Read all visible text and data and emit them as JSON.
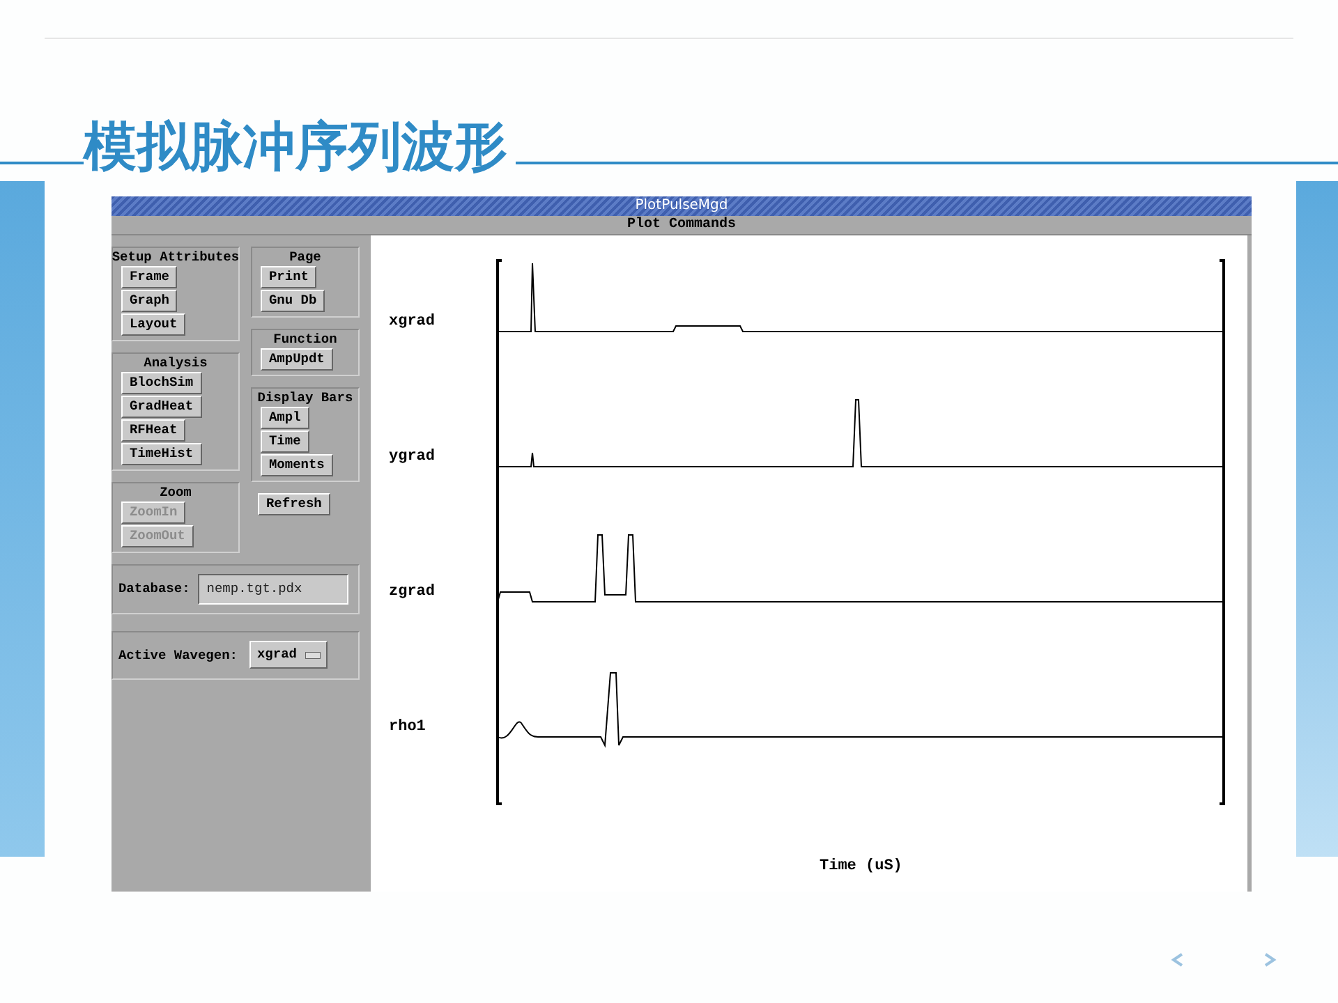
{
  "slide": {
    "title": "模拟脉冲序列波形"
  },
  "window": {
    "title": "PlotPulseMgd",
    "menu_label": "Plot Commands"
  },
  "panel": {
    "columns": [
      [
        {
          "kind": "group",
          "title": "Setup Attributes",
          "buttons": [
            {
              "label": "Frame",
              "disabled": false
            },
            {
              "label": "Graph",
              "disabled": false
            },
            {
              "label": "Layout",
              "disabled": false
            }
          ]
        },
        {
          "kind": "group",
          "title": "Analysis",
          "buttons": [
            {
              "label": "BlochSim",
              "disabled": false
            },
            {
              "label": "GradHeat",
              "disabled": false
            },
            {
              "label": "RFHeat",
              "disabled": false
            },
            {
              "label": "TimeHist",
              "disabled": false
            }
          ]
        },
        {
          "kind": "group",
          "title": "Zoom",
          "buttons": [
            {
              "label": "ZoomIn",
              "disabled": true
            },
            {
              "label": "ZoomOut",
              "disabled": true
            }
          ]
        }
      ],
      [
        {
          "kind": "group",
          "title": "Page",
          "buttons": [
            {
              "label": "Print",
              "disabled": false
            },
            {
              "label": "Gnu Db",
              "disabled": false
            }
          ]
        },
        {
          "kind": "group",
          "title": "Function",
          "buttons": [
            {
              "label": "AmpUpdt",
              "disabled": false
            }
          ]
        },
        {
          "kind": "group",
          "title": "Display Bars",
          "buttons": [
            {
              "label": "Ampl",
              "disabled": false
            },
            {
              "label": "Time",
              "disabled": false
            },
            {
              "label": "Moments",
              "disabled": false
            }
          ]
        },
        {
          "kind": "button",
          "label": "Refresh",
          "disabled": false
        }
      ]
    ],
    "database": {
      "label": "Database:",
      "value": "nemp.tgt.pdx"
    },
    "wavegen": {
      "label": "Active Wavegen:",
      "value": "xgrad"
    }
  },
  "plot": {
    "traces": [
      "xgrad",
      "ygrad",
      "zgrad",
      "rho1"
    ],
    "xlabel": "Time (uS)"
  }
}
